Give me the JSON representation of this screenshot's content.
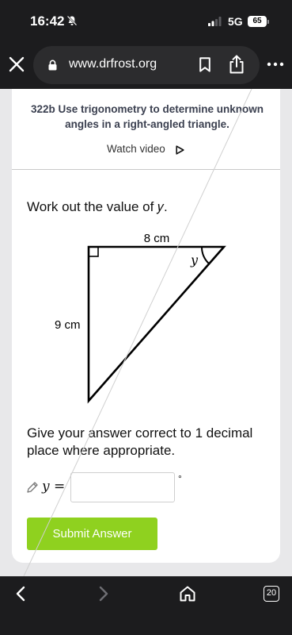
{
  "status_bar": {
    "time": "16:42",
    "network": "5G",
    "battery": "65"
  },
  "browser": {
    "url": "www.drfrost.org"
  },
  "task": {
    "title": "322b Use trigonometry to determine unknown angles in a right-angled triangle.",
    "watch_video_label": "Watch video"
  },
  "question": {
    "prompt": "Work out the value of 𝑦.",
    "diagram": {
      "top_side_label": "8 cm",
      "left_side_label": "9 cm",
      "angle_label": "y"
    },
    "instruction": "Give your answer correct to 1 decimal place where appropriate.",
    "answer_variable": "𝑦 =",
    "answer_value": "",
    "answer_unit": "°"
  },
  "actions": {
    "submit_label": "Submit Answer"
  },
  "bottom_nav": {
    "tab_count": "20"
  },
  "colors": {
    "submit": "#8fd11f",
    "chrome": "#1c1c1e",
    "url_bar": "#2c2c2e"
  }
}
